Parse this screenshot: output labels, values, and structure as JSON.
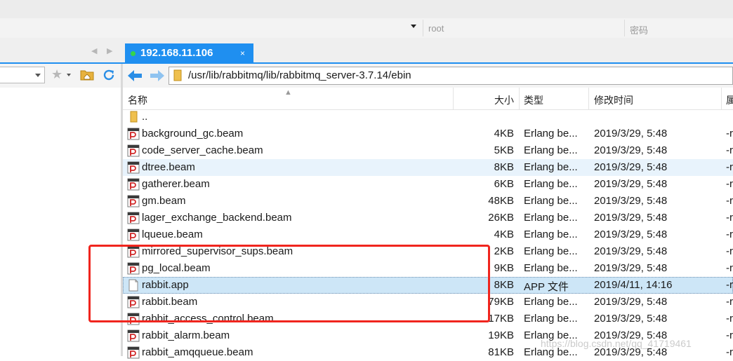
{
  "credentials": {
    "user_placeholder": "root",
    "password_placeholder": "密码"
  },
  "tab": {
    "label": "192.168.11.106",
    "close": "×",
    "status_color": "#35d64a",
    "left_arrow": "◀",
    "right_arrow": "▶"
  },
  "path": {
    "value": "/usr/lib/rabbitmq/lib/rabbitmq_server-3.7.14/ebin"
  },
  "columns": {
    "name": "名称",
    "size": "大小",
    "type": "类型",
    "modified": "修改时间",
    "attr": "属"
  },
  "files": [
    {
      "name": "..",
      "size": "",
      "type": "",
      "modified": "",
      "attr": "",
      "icon": "folder-icon"
    },
    {
      "name": "background_gc.beam",
      "size": "4KB",
      "type": "Erlang be...",
      "modified": "2019/3/29, 5:48",
      "attr": "-r",
      "icon": "beam-file-icon"
    },
    {
      "name": "code_server_cache.beam",
      "size": "5KB",
      "type": "Erlang be...",
      "modified": "2019/3/29, 5:48",
      "attr": "-r",
      "icon": "beam-file-icon"
    },
    {
      "name": "dtree.beam",
      "size": "8KB",
      "type": "Erlang be...",
      "modified": "2019/3/29, 5:48",
      "attr": "-r",
      "icon": "beam-file-icon"
    },
    {
      "name": "gatherer.beam",
      "size": "6KB",
      "type": "Erlang be...",
      "modified": "2019/3/29, 5:48",
      "attr": "-r",
      "icon": "beam-file-icon"
    },
    {
      "name": "gm.beam",
      "size": "48KB",
      "type": "Erlang be...",
      "modified": "2019/3/29, 5:48",
      "attr": "-r",
      "icon": "beam-file-icon"
    },
    {
      "name": "lager_exchange_backend.beam",
      "size": "26KB",
      "type": "Erlang be...",
      "modified": "2019/3/29, 5:48",
      "attr": "-r",
      "icon": "beam-file-icon"
    },
    {
      "name": "lqueue.beam",
      "size": "4KB",
      "type": "Erlang be...",
      "modified": "2019/3/29, 5:48",
      "attr": "-r",
      "icon": "beam-file-icon"
    },
    {
      "name": "mirrored_supervisor_sups.beam",
      "size": "2KB",
      "type": "Erlang be...",
      "modified": "2019/3/29, 5:48",
      "attr": "-r",
      "icon": "beam-file-icon"
    },
    {
      "name": "pg_local.beam",
      "size": "9KB",
      "type": "Erlang be...",
      "modified": "2019/3/29, 5:48",
      "attr": "-r",
      "icon": "beam-file-icon"
    },
    {
      "name": "rabbit.app",
      "size": "8KB",
      "type": "APP 文件",
      "modified": "2019/4/11, 14:16",
      "attr": "-r",
      "icon": "app-file-icon"
    },
    {
      "name": "rabbit.beam",
      "size": "79KB",
      "type": "Erlang be...",
      "modified": "2019/3/29, 5:48",
      "attr": "-r",
      "icon": "beam-file-icon"
    },
    {
      "name": "rabbit_access_control.beam",
      "size": "17KB",
      "type": "Erlang be...",
      "modified": "2019/3/29, 5:48",
      "attr": "-r",
      "icon": "beam-file-icon"
    },
    {
      "name": "rabbit_alarm.beam",
      "size": "19KB",
      "type": "Erlang be...",
      "modified": "2019/3/29, 5:48",
      "attr": "-r",
      "icon": "beam-file-icon"
    },
    {
      "name": "rabbit_amqqueue.beam",
      "size": "81KB",
      "type": "Erlang be...",
      "modified": "2019/3/29, 5:48",
      "attr": "-r",
      "icon": "beam-file-icon"
    }
  ],
  "watermark": "https://blog.csdn.net/qq_41719461",
  "colors": {
    "tab_active": "#1f8ff0",
    "hover_row": "#e8f3fc",
    "selected_row": "#cde6f7",
    "annotation": "#f0251e"
  }
}
